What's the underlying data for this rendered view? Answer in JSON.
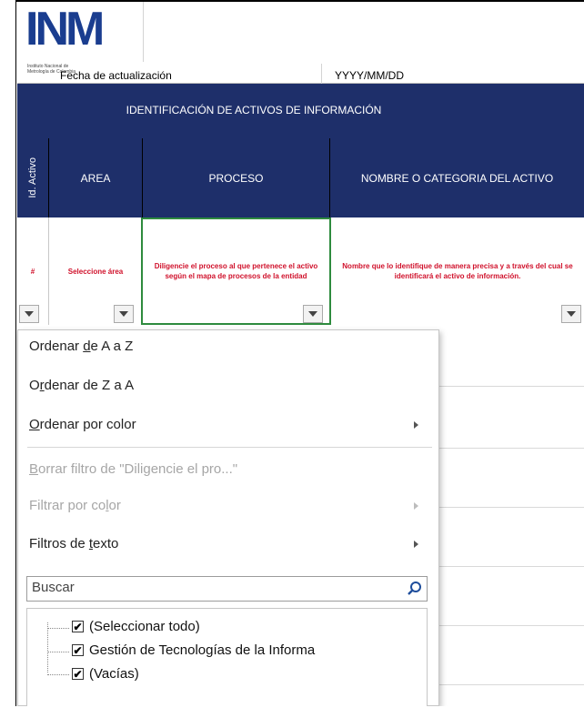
{
  "logo": {
    "text": "INM",
    "subtitle": "Instituto Nacional de Metrología de Colombia"
  },
  "sheet": {
    "date_label": "Fecha de actualización",
    "date_value": "YYYY/MM/DD",
    "band_title": "IDENTIFICACIÓN DE ACTIVOS DE INFORMACIÓN",
    "headers": {
      "id": "Id. Activo",
      "area": "AREA",
      "proceso": "PROCESO",
      "nombre": "NOMBRE O CATEGORIA DEL ACTIVO"
    },
    "example": {
      "id": "#",
      "area": "Seleccione área",
      "proceso": "Diligencie el proceso al que pertenece el activo según el mapa de procesos de la entidad",
      "nombre": "Nombre que lo identifique de manera precisa y a través del cual se identificará el activo de información."
    }
  },
  "menu": {
    "sort_az": {
      "pre": "Ordenar ",
      "key": "d",
      "post": "e A a Z"
    },
    "sort_za": {
      "pre": "O",
      "key": "r",
      "post": "denar de Z a A"
    },
    "sort_color": {
      "pre": "",
      "key": "O",
      "post": "rdenar por color"
    },
    "clear_filter": {
      "pre": "",
      "key": "B",
      "post": "orrar filtro de \"Diligencie el pro...\""
    },
    "filter_color": {
      "pre": "Filtrar por co",
      "key": "l",
      "post": "or"
    },
    "text_filters": {
      "pre": "Filtros de ",
      "key": "t",
      "post": "exto"
    },
    "search_placeholder": "Buscar",
    "tree": [
      {
        "label": "(Seleccionar todo)",
        "checked": true
      },
      {
        "label": "Gestión de Tecnologías de la Informa",
        "checked": true
      },
      {
        "label": "(Vacías)",
        "checked": true
      }
    ]
  },
  "colors": {
    "header_bg": "#1e2f6a",
    "example_text": "#d0112b",
    "logo": "#1a3d8f",
    "selected_border": "#2e8b3e"
  },
  "icons": [
    "dropdown-arrow-icon",
    "submenu-arrow-icon",
    "search-icon",
    "checkbox-checked-icon"
  ]
}
